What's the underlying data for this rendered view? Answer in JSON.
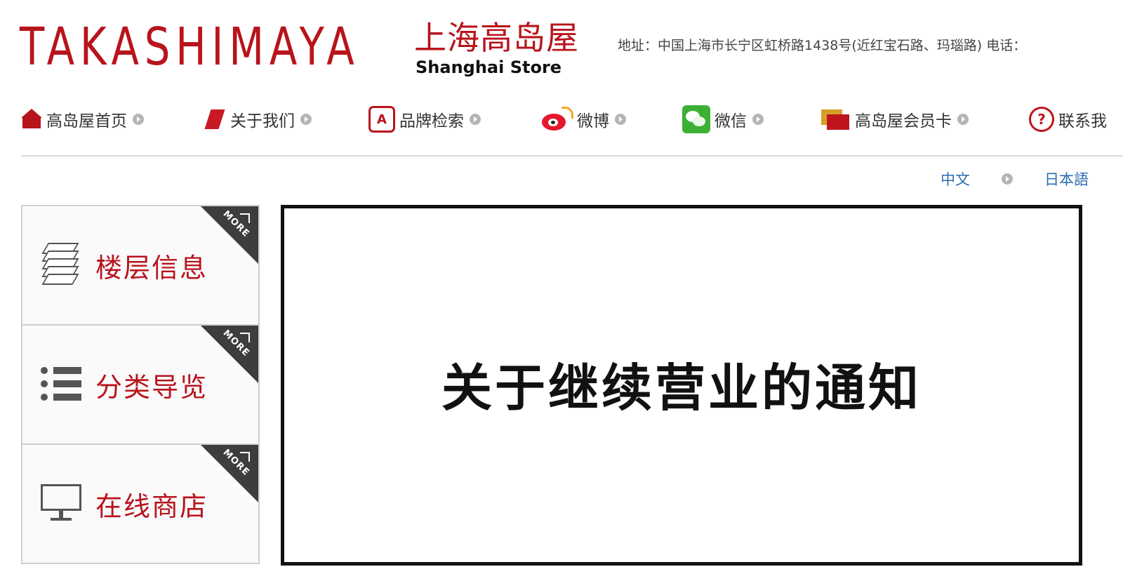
{
  "header": {
    "logo_en": "TAKASHIMAYA",
    "logo_cn": "上海高岛屋",
    "store_name": "Shanghai Store",
    "address": "地址：中国上海市长宁区虹桥路1438号(近红宝石路、玛瑙路) 电话："
  },
  "nav": {
    "items": [
      {
        "label": "高岛屋首页",
        "icon": "home-icon"
      },
      {
        "label": "关于我们",
        "icon": "about-icon"
      },
      {
        "label": "品牌检索",
        "icon": "brand-search-icon"
      },
      {
        "label": "微博",
        "icon": "weibo-icon"
      },
      {
        "label": "微信",
        "icon": "wechat-icon"
      },
      {
        "label": "高岛屋会员卡",
        "icon": "member-card-icon"
      },
      {
        "label": "联系我",
        "icon": "help-icon"
      }
    ]
  },
  "language": {
    "chinese": "中文",
    "japanese": "日本語"
  },
  "sidebar": {
    "items": [
      {
        "label": "楼层信息",
        "icon": "layers-icon",
        "more": "MORE"
      },
      {
        "label": "分类导览",
        "icon": "list-icon",
        "more": "MORE"
      },
      {
        "label": "在线商店",
        "icon": "monitor-icon",
        "more": "MORE"
      }
    ]
  },
  "notice": {
    "title": "关于继续营业的通知"
  },
  "colors": {
    "brand_red": "#b8141c",
    "link_blue": "#2b6cb0",
    "corner_dark": "#3d3d3d"
  }
}
